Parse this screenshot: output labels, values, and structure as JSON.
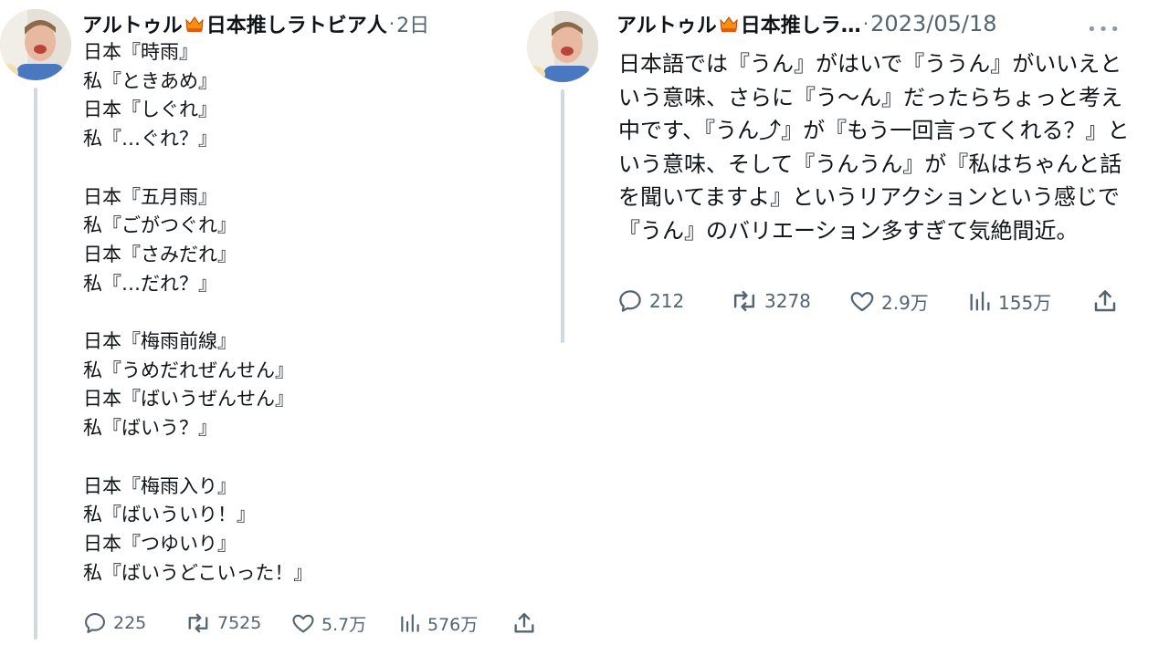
{
  "posts": [
    {
      "author_name": "アルトゥル",
      "author_suffix": "日本推しラトビア人",
      "timestamp": "2日",
      "body": "日本『時雨』\n私『ときあめ』\n日本『しぐれ』\n私『…ぐれ？』\n\n日本『五月雨』\n私『ごがつぐれ』\n日本『さみだれ』\n私『…だれ？』\n\n日本『梅雨前線』\n私『うめだれぜんせん』\n日本『ばいうぜんせん』\n私『ばいう？』\n\n日本『梅雨入り』\n私『ばいういり！』\n日本『つゆいり』\n私『ばいうどこいった！』",
      "actions": {
        "replies": "225",
        "reposts": "7525",
        "likes": "5.7万",
        "views": "576万"
      }
    },
    {
      "author_name": "アルトゥル",
      "author_suffix": "日本推しラ…",
      "timestamp": "2023/05/18",
      "body": "日本語では『うん』がはいで『ううん』がいいえという意味、さらに『う〜ん』だったらちょっと考え中です、『うん⤴︎』が『もう一回言ってくれる？』という意味、そして『うんうん』が『私はちゃんと話を聞いてますよ』というリアクションという感じで『うん』のバリエーション多すぎて気絶間近。",
      "actions": {
        "replies": "212",
        "reposts": "3278",
        "likes": "2.9万",
        "views": "155万"
      }
    }
  ],
  "ui": {
    "separator": "·",
    "more_icon": "•••"
  },
  "colors": {
    "text": "#0f1419",
    "muted": "#536471",
    "thread_line": "#cfd9de",
    "crown": "#f4900c"
  }
}
